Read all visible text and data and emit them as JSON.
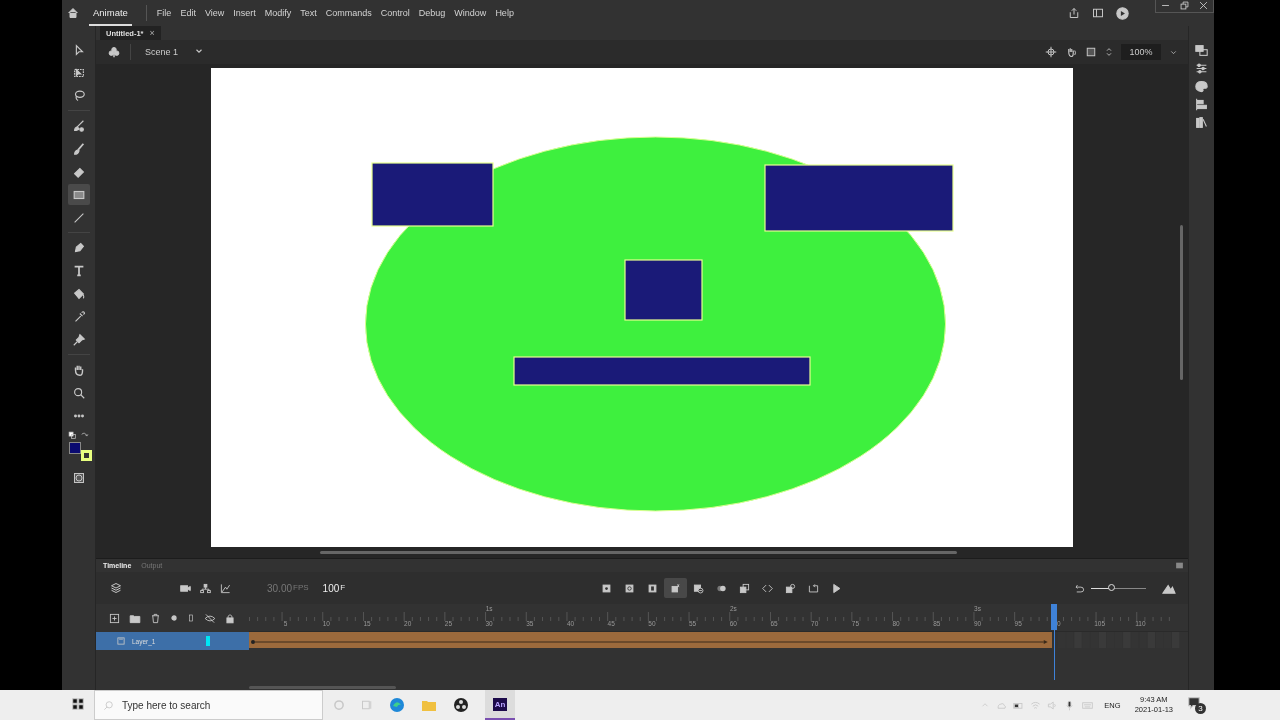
{
  "menubar": {
    "workspace": "Animate",
    "menus": [
      "File",
      "Edit",
      "View",
      "Insert",
      "Modify",
      "Text",
      "Commands",
      "Control",
      "Debug",
      "Window",
      "Help"
    ]
  },
  "document_tabs": [
    {
      "label": "Untitled-1*",
      "close": "×",
      "selected": true
    }
  ],
  "stage_header": {
    "scene": "Scene 1",
    "zoom": "100%"
  },
  "tool_groups": [
    [
      {
        "kind": "select",
        "selected": false
      },
      {
        "kind": "subselect",
        "selected": false
      },
      {
        "kind": "lasso",
        "selected": false
      }
    ],
    [
      {
        "kind": "paintbrush",
        "selected": false
      },
      {
        "kind": "brush",
        "selected": false
      },
      {
        "kind": "eraser",
        "selected": false
      },
      {
        "kind": "rectangle",
        "selected": true
      },
      {
        "kind": "line",
        "selected": false
      }
    ],
    [
      {
        "kind": "pen",
        "selected": false
      },
      {
        "kind": "text",
        "selected": false
      },
      {
        "kind": "bucket",
        "selected": false
      },
      {
        "kind": "eyedropper",
        "selected": false
      },
      {
        "kind": "pin",
        "selected": false
      }
    ],
    [
      {
        "kind": "hand",
        "selected": false
      },
      {
        "kind": "zoom",
        "selected": false
      },
      {
        "kind": "more",
        "selected": false
      }
    ]
  ],
  "timeline": {
    "tabs": [
      {
        "label": "Timeline",
        "selected": true
      },
      {
        "label": "Output",
        "selected": false
      }
    ],
    "fps": "30.00",
    "fps_unit": "FPS",
    "frame": "100",
    "frame_unit": "F",
    "controls": [
      {
        "kind": "keyframe",
        "selected": false
      },
      {
        "kind": "blank-keyframe",
        "selected": false
      },
      {
        "kind": "frame",
        "selected": false
      },
      {
        "kind": "auto-keyframe",
        "selected": true
      },
      {
        "kind": "remove-frame",
        "selected": false
      },
      {
        "kind": "onion",
        "selected": false
      },
      {
        "kind": "edit-multiple",
        "selected": false
      },
      {
        "kind": "step",
        "selected": false
      },
      {
        "kind": "copy",
        "selected": false
      },
      {
        "kind": "loop",
        "selected": false
      },
      {
        "kind": "play",
        "selected": false
      }
    ],
    "seconds": [
      "1s",
      "2s",
      "3s"
    ],
    "frame_numbers": [
      "5",
      "10",
      "15",
      "20",
      "25",
      "30",
      "35",
      "40",
      "45",
      "50",
      "55",
      "60",
      "65",
      "70",
      "75",
      "80",
      "85",
      "90",
      "95",
      "0",
      "105",
      "110"
    ],
    "layers": [
      {
        "name": "Layer_1",
        "selected": true,
        "color": "#00e5f5"
      }
    ],
    "playhead": {
      "level": 0.87
    },
    "zoom_slider": {
      "level": 0.38
    }
  },
  "taskbar": {
    "search_placeholder": "Type here to search",
    "active_app": "An",
    "language": "ENG",
    "time": "9:43 AM",
    "date": "2021-01-13",
    "notifications": "3"
  }
}
